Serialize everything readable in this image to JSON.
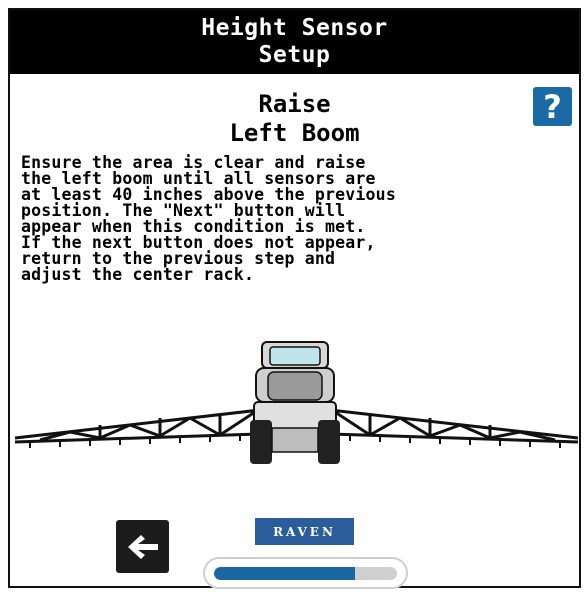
{
  "header": {
    "title_line1": "Height Sensor",
    "title_line2": "Setup"
  },
  "step": {
    "title_line1": "Raise",
    "title_line2": "Left Boom"
  },
  "help": {
    "label": "?",
    "icon": "help-icon"
  },
  "instructions": "Ensure the area is clear and raise\nthe left boom until all sensors are\nat least 40 inches above the previous\nposition. The \"Next\" button will\nappear when this condition is met.\nIf the next button does not appear,\nreturn to the previous step and\nadjust the center rack.",
  "illustration": "sprayer-left-boom-raised",
  "footer": {
    "back_icon": "arrow-left-icon",
    "logo_text": "RAVEN",
    "progress_fraction": 0.77
  },
  "colors": {
    "header_bg": "#000000",
    "accent_blue": "#1a66a3",
    "logo_blue": "#2a5d9a",
    "progress_track": "#cfcfcf"
  }
}
